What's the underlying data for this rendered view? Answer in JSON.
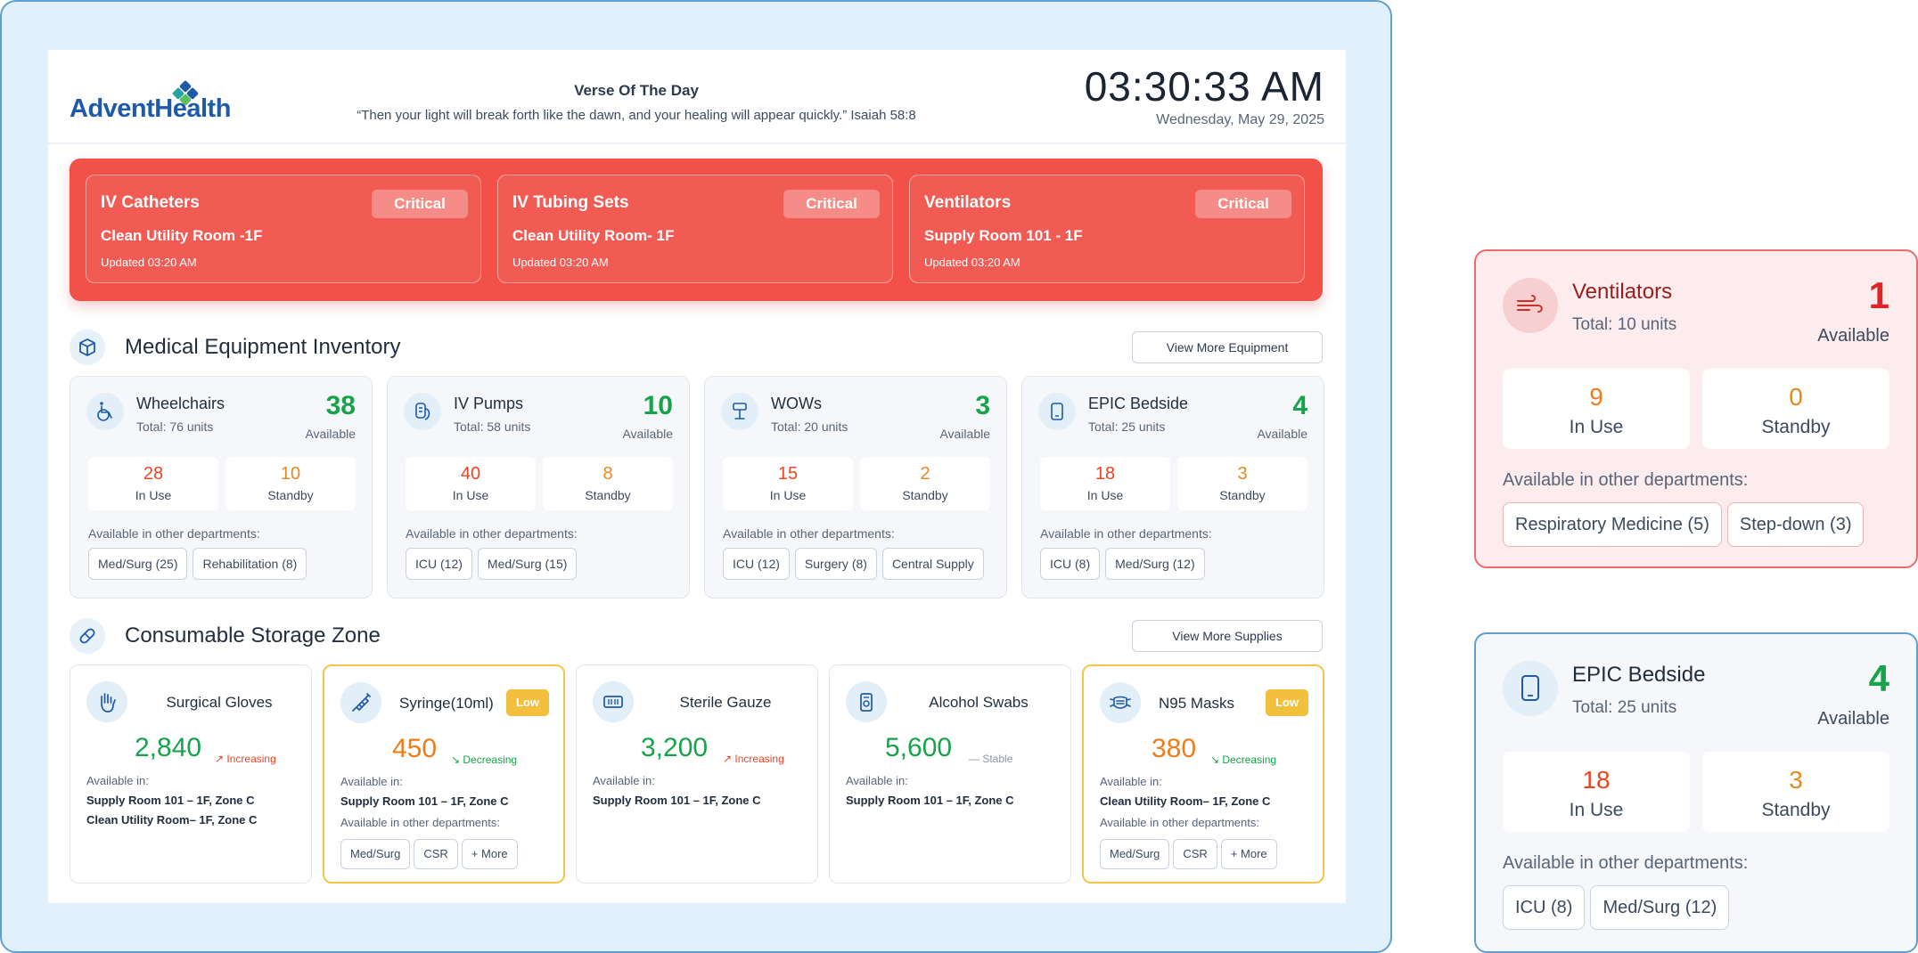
{
  "header": {
    "logo_text": "AdventHealth",
    "verse_title": "Verse Of The Day",
    "verse_text": "“Then your light will break forth like the dawn, and your healing will appear quickly.” Isaiah 58:8",
    "time": "03:30:33 AM",
    "date": "Wednesday, May 29, 2025"
  },
  "alerts": [
    {
      "name": "IV Catheters",
      "status": "Critical",
      "location": "Clean Utility Room -1F",
      "updated": "Updated 03:20 AM"
    },
    {
      "name": "IV Tubing Sets",
      "status": "Critical",
      "location": "Clean Utility Room- 1F",
      "updated": "Updated 03:20 AM"
    },
    {
      "name": "Ventilators",
      "status": "Critical",
      "location": "Supply Room 101 - 1F",
      "updated": "Updated 03:20 AM"
    }
  ],
  "equipment": {
    "title": "Medical Equipment Inventory",
    "button": "View More Equipment",
    "available_label": "Available",
    "in_use_label": "In Use",
    "standby_label": "Standby",
    "other_label": "Available in other departments:",
    "items": [
      {
        "name": "Wheelchairs",
        "total": "Total: 76 units",
        "available": "38",
        "in_use": "28",
        "standby": "10",
        "icon": "wheelchair-icon",
        "departments": [
          "Med/Surg (25)",
          "Rehabilitation (8)"
        ]
      },
      {
        "name": "IV Pumps",
        "total": "Total: 58 units",
        "available": "10",
        "in_use": "40",
        "standby": "8",
        "icon": "iv-pump-icon",
        "departments": [
          "ICU (12)",
          "Med/Surg (15)"
        ]
      },
      {
        "name": "WOWs",
        "total": "Total: 20 units",
        "available": "3",
        "in_use": "15",
        "standby": "2",
        "icon": "workstation-icon",
        "departments": [
          "ICU (12)",
          "Surgery (8)",
          "Central Supply"
        ]
      },
      {
        "name": "EPIC Bedside",
        "total": "Total: 25 units",
        "available": "4",
        "in_use": "18",
        "standby": "3",
        "icon": "tablet-icon",
        "departments": [
          "ICU (8)",
          "Med/Surg (12)"
        ]
      }
    ]
  },
  "consumables": {
    "title": "Consumable Storage Zone",
    "button": "View More Supplies",
    "available_in_label": "Available in:",
    "other_label": "Available in other departments:",
    "items": [
      {
        "name": "Surgical Gloves",
        "qty": "2,840",
        "trend": "Increasing",
        "badge": "",
        "locations": [
          "Supply Room 101 – 1F, Zone C",
          "Clean Utility Room– 1F, Zone C"
        ],
        "departments": [],
        "icon": "glove-icon"
      },
      {
        "name": "Syringe(10ml)",
        "qty": "450",
        "trend": "Decreasing",
        "badge": "Low",
        "locations": [
          "Supply Room 101 – 1F, Zone C"
        ],
        "departments": [
          "Med/Surg",
          "CSR",
          "+ More"
        ],
        "icon": "syringe-icon"
      },
      {
        "name": "Sterile Gauze",
        "qty": "3,200",
        "trend": "Increasing",
        "badge": "",
        "locations": [
          "Supply Room 101 – 1F, Zone C"
        ],
        "departments": [],
        "icon": "gauze-icon"
      },
      {
        "name": "Alcohol Swabs",
        "qty": "5,600",
        "trend": "Stable",
        "badge": "",
        "locations": [
          "Supply Room 101 – 1F, Zone C"
        ],
        "departments": [],
        "icon": "swab-icon"
      },
      {
        "name": "N95 Masks",
        "qty": "380",
        "trend": "Decreasing",
        "badge": "Low",
        "locations": [
          "Clean Utility Room– 1F, Zone C"
        ],
        "departments": [
          "Med/Surg",
          "CSR",
          "+ More"
        ],
        "icon": "mask-icon"
      }
    ]
  },
  "zoom_ventilators": {
    "name": "Ventilators",
    "total": "Total: 10 units",
    "available": "1",
    "available_label": "Available",
    "in_use": "9",
    "in_use_label": "In Use",
    "standby": "0",
    "standby_label": "Standby",
    "other_label": "Available in other departments:",
    "departments": [
      "Respiratory Medicine (5)",
      "Step-down (3)"
    ]
  },
  "zoom_epic": {
    "name": "EPIC Bedside",
    "total": "Total: 25 units",
    "available": "4",
    "available_label": "Available",
    "in_use": "18",
    "in_use_label": "In Use",
    "standby": "3",
    "standby_label": "Standby",
    "other_label": "Available in other departments:",
    "departments": [
      "ICU (8)",
      "Med/Surg (12)"
    ]
  },
  "colors": {
    "critical_red": "#f2514a",
    "available_green": "#16a34a",
    "in_use_red": "#ef4423",
    "standby_orange": "#e58a1f",
    "low_badge": "#f3c03d",
    "frame_blue": "#e1f0fb"
  }
}
